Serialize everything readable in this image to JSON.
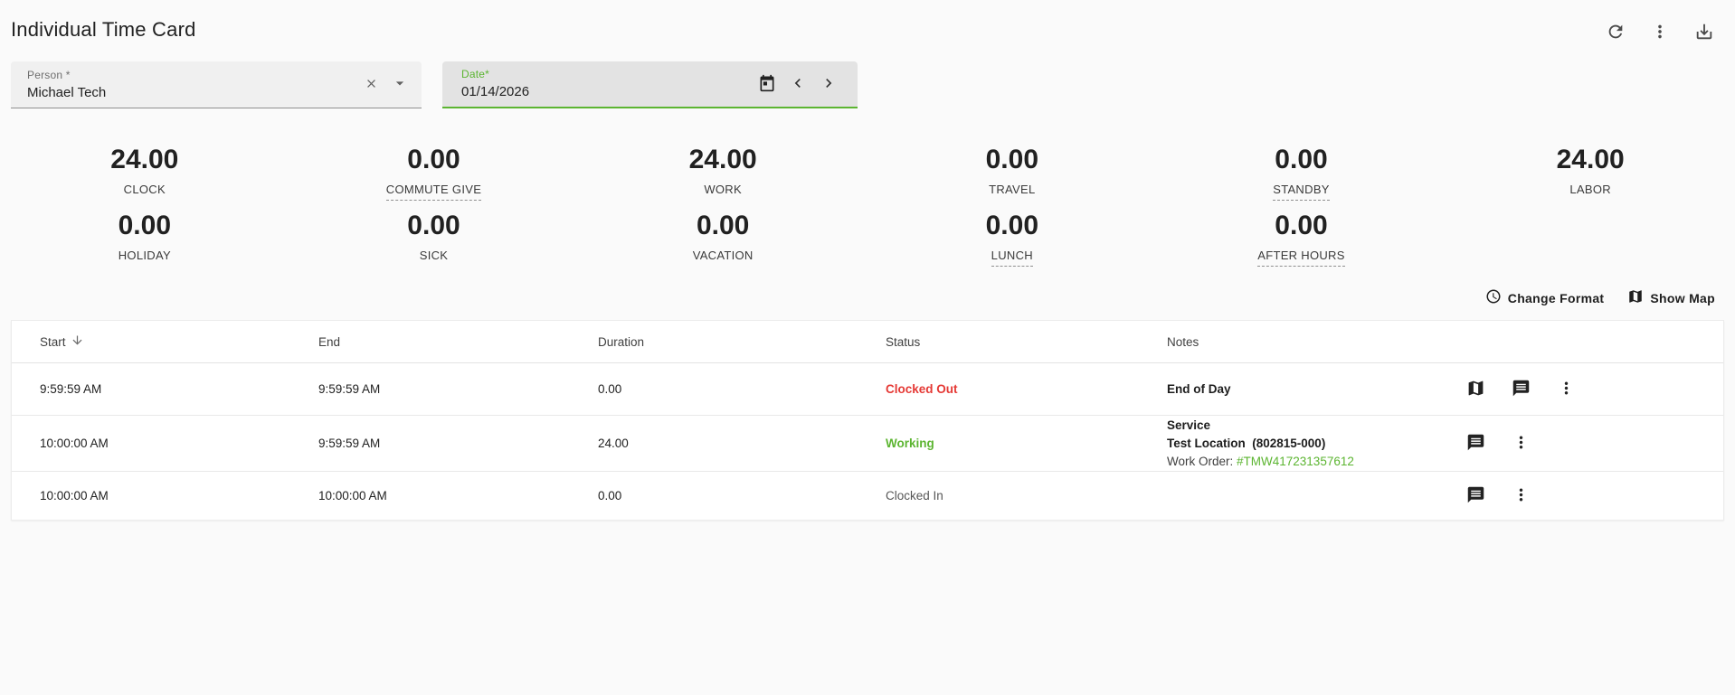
{
  "page": {
    "title": "Individual Time Card"
  },
  "filters": {
    "person": {
      "label": "Person *",
      "value": "Michael Tech"
    },
    "date": {
      "label": "Date*",
      "value": "01/14/2026"
    }
  },
  "summary": {
    "clock": {
      "value": "24.00",
      "label": "CLOCK"
    },
    "commute_give": {
      "value": "0.00",
      "label": "COMMUTE GIVE"
    },
    "work": {
      "value": "24.00",
      "label": "WORK"
    },
    "travel": {
      "value": "0.00",
      "label": "TRAVEL"
    },
    "standby": {
      "value": "0.00",
      "label": "STANDBY"
    },
    "labor": {
      "value": "24.00",
      "label": "LABOR"
    },
    "holiday": {
      "value": "0.00",
      "label": "HOLIDAY"
    },
    "sick": {
      "value": "0.00",
      "label": "SICK"
    },
    "vacation": {
      "value": "0.00",
      "label": "VACATION"
    },
    "lunch": {
      "value": "0.00",
      "label": "LUNCH"
    },
    "after_hours": {
      "value": "0.00",
      "label": "AFTER HOURS"
    }
  },
  "toolbar": {
    "change_format_label": "Change Format",
    "show_map_label": "Show Map"
  },
  "table": {
    "headers": [
      "Start",
      "End",
      "Duration",
      "Status",
      "Notes"
    ],
    "rows": [
      {
        "start": "9:59:59 AM",
        "end": "9:59:59 AM",
        "duration": "0.00",
        "status": "Clocked Out",
        "note_title": "End of Day"
      },
      {
        "start": "10:00:00 AM",
        "end": "9:59:59 AM",
        "duration": "24.00",
        "status": "Working",
        "note_line1": "Service",
        "note_line2": "Test Location  (802815-000)",
        "work_order_label": "Work Order: ",
        "work_order_value": "#TMW417231357612"
      },
      {
        "start": "10:00:00 AM",
        "end": "10:00:00 AM",
        "duration": "0.00",
        "status": "Clocked In"
      }
    ]
  },
  "colors": {
    "accent_green": "#5cb531",
    "status_red": "#e53935"
  }
}
